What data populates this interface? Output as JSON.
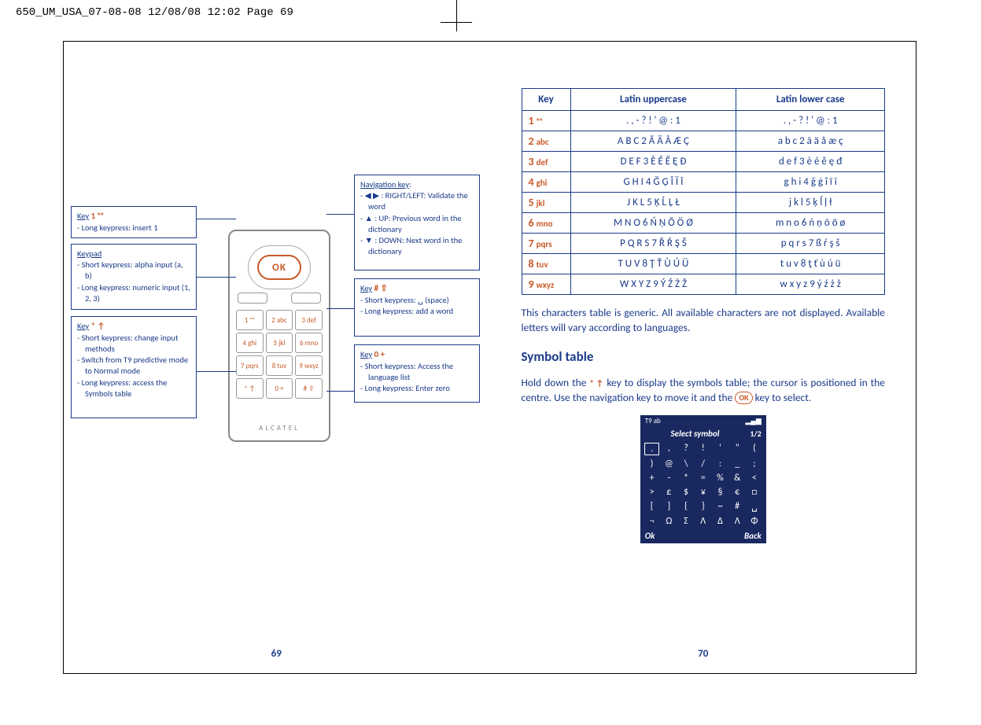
{
  "header_strip": "650_UM_USA_07-08-08  12/08/08  12:02  Page 69",
  "left_page": {
    "page_num": "69",
    "phone_brand": "ALCATEL",
    "ok_label": "OK",
    "keypad_labels": [
      "1  ᵒᵒ",
      "2 abc",
      "3 def",
      "4 ghi",
      "5 jkl",
      "6 mno",
      "7 pqrs",
      "8 tuv",
      "9 wxyz",
      "* ↑",
      "0 +",
      "# ⇧"
    ],
    "callouts": {
      "key1": {
        "title": "Key",
        "icon": "1  ᵒᵒ",
        "items": [
          "Long keypress: insert 1"
        ]
      },
      "keypad": {
        "title": "Keypad",
        "items": [
          "Short keypress: alpha input (a, b)",
          "Long keypress: numeric input (1, 2, 3)"
        ]
      },
      "keystar": {
        "title": "Key",
        "icon": "* ↑",
        "items": [
          "Short keypress: change input methods",
          "Switch from T9 predictive mode to Normal mode",
          "Long keypress: access the Symbols table"
        ]
      },
      "nav": {
        "title": "Navigation key",
        "items": [
          "◀ ▶ : RIGHT/LEFT: Validate the word",
          "▲ : UP: Previous word in the dictionary",
          "▼ : DOWN: Next word in the dictionary"
        ]
      },
      "keyhash": {
        "title": "Key",
        "icon": "# ⇧",
        "items": [
          "Short keypress: ␣ (space)",
          "Long keypress: add a word"
        ]
      },
      "key0": {
        "title": "Key",
        "icon": "0  +",
        "items": [
          "Short keypress: Access the language list",
          "Long keypress: Enter zero"
        ]
      }
    }
  },
  "right_page": {
    "page_num": "70",
    "table": {
      "headers": [
        "Key",
        "Latin uppercase",
        "Latin lower case"
      ],
      "rows": [
        {
          "key_num": "1",
          "key_let": "ᵒᵒ",
          "upper": ". , - ? ! ' @ : 1",
          "lower": ". , - ? ! ' @ : 1"
        },
        {
          "key_num": "2",
          "key_let": "abc",
          "upper": "A B C 2 Ã Ä Å Æ Ç",
          "lower": "a b c 2 ã ä å æ ç"
        },
        {
          "key_num": "3",
          "key_let": "def",
          "upper": "D E F 3 È É Ě Ę Ð",
          "lower": "d e f 3 è é ě ę đ"
        },
        {
          "key_num": "4",
          "key_let": "ghi",
          "upper": "G H I 4 Ğ Ģ Î Ï Ī",
          "lower": "g h i 4 ğ ģ î ï ī"
        },
        {
          "key_num": "5",
          "key_let": "jkl",
          "upper": "J K L 5 Ķ Ĺ Ļ Ł",
          "lower": "j k l 5 ķ ĺ ļ ł"
        },
        {
          "key_num": "6",
          "key_let": "mno",
          "upper": "M N O 6 Ń Ņ Õ Ö Ø",
          "lower": "m n o 6 ń ņ õ ö ø"
        },
        {
          "key_num": "7",
          "key_let": "pqrs",
          "upper": "P Q R S 7 Ř Ŕ Ş Š",
          "lower": "p q r s 7 ß ŕ ş š"
        },
        {
          "key_num": "8",
          "key_let": "tuv",
          "upper": "T U V 8 Ţ Ť Ù Ú Ü",
          "lower": "t u v 8 ţ ť ù ú ü"
        },
        {
          "key_num": "9",
          "key_let": "wxyz",
          "upper": "W X Y Z 9 Ý Ź Ż Ž",
          "lower": "w x y z 9 ý ź ż ž"
        }
      ]
    },
    "para1": "This characters table is generic. All available characters are not displayed. Available letters will vary according to languages.",
    "h2": "Symbol table",
    "para2_a": "Hold down the ",
    "para2_icon": "* ↑",
    "para2_b": " key to display the symbols table; the cursor is positioned in the centre. Use the navigation key to move it and the ",
    "para2_ok": "OK",
    "para2_c": " key to select.",
    "symbol_screenshot": {
      "top_left": "T9 ab",
      "top_right": "▂▄▆",
      "title": "Select symbol",
      "page": "1/2",
      "rows": [
        [
          ".",
          ",",
          "?",
          "!",
          "'",
          "\"",
          "("
        ],
        [
          ")",
          "@",
          "\\",
          "/",
          ":",
          "_",
          ";"
        ],
        [
          "+",
          "-",
          "*",
          "=",
          "%",
          "&",
          "<"
        ],
        [
          ">",
          "£",
          "$",
          "¥",
          "§",
          "€",
          "□"
        ],
        [
          "[",
          "]",
          "{",
          "}",
          "~",
          "#",
          "␣"
        ],
        [
          "¬",
          "Ω",
          "Σ",
          "Λ",
          "Δ",
          "Λ",
          "Φ"
        ]
      ],
      "softkey_left": "Ok",
      "softkey_right": "Back"
    }
  }
}
